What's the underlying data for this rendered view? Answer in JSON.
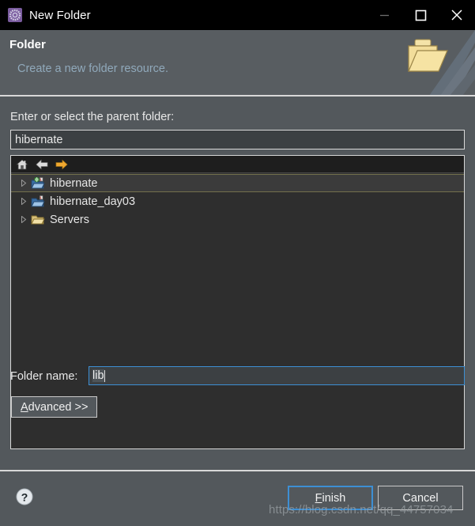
{
  "window": {
    "title": "New Folder",
    "icon": "eclipse-gear-icon",
    "controls": {
      "minimize": "minimize-icon",
      "maximize": "maximize-icon",
      "close": "close-icon"
    }
  },
  "header": {
    "title": "Folder",
    "subtitle": "Create a new folder resource.",
    "banner_icon": "open-folder-icon"
  },
  "form": {
    "parent_label": "Enter or select the parent folder:",
    "parent_value": "hibernate",
    "parent_placeholder": "",
    "folder_name_label": "Folder name:",
    "folder_name_value": "lib",
    "folder_name_placeholder": "",
    "advanced_button": {
      "mnemonic": "A",
      "rest": "dvanced >>"
    }
  },
  "tree": {
    "toolbar": [
      {
        "name": "home-icon",
        "tooltip": "Home"
      },
      {
        "name": "back-arrow-icon",
        "tooltip": "Back"
      },
      {
        "name": "forward-arrow-icon",
        "tooltip": "Forward"
      }
    ],
    "rows": [
      {
        "label": "hibernate",
        "icon": "java-project-folder-icon",
        "expandable": true,
        "selected": true
      },
      {
        "label": "hibernate_day03",
        "icon": "java-project-folder-icon",
        "expandable": true,
        "selected": false
      },
      {
        "label": "Servers",
        "icon": "folder-icon",
        "expandable": true,
        "selected": false
      }
    ]
  },
  "footer": {
    "help_icon": "help-icon",
    "finish": {
      "mnemonic": "F",
      "rest": "inish"
    },
    "cancel_label": "Cancel"
  },
  "watermark": "https://blog.csdn.net/qq_44757034",
  "colors": {
    "titlebar_bg": "#000000",
    "header_bg": "#585d61",
    "dialog_bg": "#53585c",
    "tree_bg": "#2e2e2e",
    "tree_toolbar_bg": "#1e1e1e",
    "selection_bg": "#3b3b3b",
    "selection_border": "#73704c",
    "focus_border": "#3d8fd4",
    "subtitle_text": "#90a9bb",
    "text": "#e8e8e8",
    "accent_orange": "#f0a830"
  }
}
